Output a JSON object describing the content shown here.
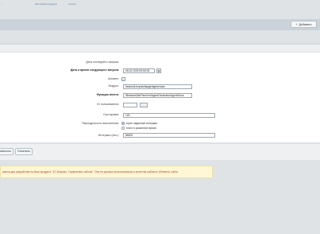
{
  "breadcrumbs": [
    "Настройки продукта",
    "Агенты"
  ],
  "toolbar": {
    "add_label": "Добавить",
    "add_icon": "plus-icon"
  },
  "form": {
    "last_run_label": "Дата последнего запуска:",
    "next_run_label": "Дата и время следующего запуска:",
    "next_run_value": "06.02.2025 05:50:00",
    "active_label": "Активен:",
    "active_checked": true,
    "module_label": "Модуль:",
    "module_value": "bestomk.bzpriceliaagentgenerator",
    "function_label": "Функция агента:",
    "function_value": "\\Bestomk\\BzPriceXml\\AgentGenerator\\AgentGene",
    "user_id_label": "ID пользователя:",
    "user_id_value": "",
    "user_id_button": "...",
    "sort_label": "Сортировка:",
    "sort_value": "100",
    "period_label": "Периодичность выполнения:",
    "period_option1": "через заданный интервал",
    "period_option2": "точно в указанное время",
    "interval_label": "Интервал (сек.):",
    "interval_value": "86400"
  },
  "footer": {
    "apply_label": "именить",
    "cancel_label": "Отменить"
  },
  "notice": {
    "text": "ижена для разработки на базе продукта \"1С-Битрикс: Управление сайтом\". Она не должна использоваться в качестве рабочего (боевого) сайта"
  }
}
